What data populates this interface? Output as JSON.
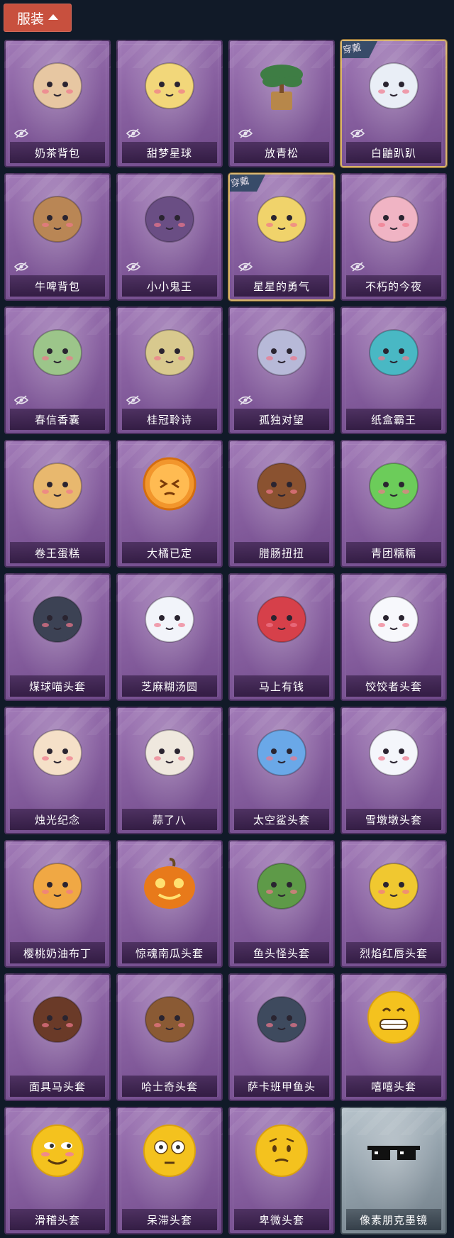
{
  "header": {
    "tab_label": "服装",
    "expanded": true
  },
  "equipped_badge": "穿戴",
  "items": [
    {
      "name": "奶茶背包",
      "hidden": true,
      "equipped": false,
      "icon": "milk-tea-backpack-icon",
      "color": "#e7c7a2"
    },
    {
      "name": "甜梦星球",
      "hidden": true,
      "equipped": false,
      "icon": "sweet-dream-moon-icon",
      "color": "#f2d77a"
    },
    {
      "name": "放青松",
      "hidden": true,
      "equipped": false,
      "icon": "bonsai-pine-icon",
      "color": "#3e7d44"
    },
    {
      "name": "白鼬趴趴",
      "hidden": true,
      "equipped": true,
      "icon": "white-weasel-icon",
      "color": "#e9eef6"
    },
    {
      "name": "牛啤背包",
      "hidden": true,
      "equipped": false,
      "icon": "cow-beer-backpack-icon",
      "color": "#b98655"
    },
    {
      "name": "小小鬼王",
      "hidden": true,
      "equipped": false,
      "icon": "little-ghost-king-icon",
      "color": "#6a4e84"
    },
    {
      "name": "星星的勇气",
      "hidden": true,
      "equipped": true,
      "icon": "star-courage-icon",
      "color": "#f0d36b"
    },
    {
      "name": "不朽的今夜",
      "hidden": true,
      "equipped": false,
      "icon": "immortal-tonight-icon",
      "color": "#f0b4c4"
    },
    {
      "name": "春信香囊",
      "hidden": true,
      "equipped": false,
      "icon": "spring-sachet-icon",
      "color": "#9cc58a"
    },
    {
      "name": "桂冠聆诗",
      "hidden": true,
      "equipped": false,
      "icon": "laurel-poem-icon",
      "color": "#d8c98e"
    },
    {
      "name": "孤独对望",
      "hidden": true,
      "equipped": false,
      "icon": "lonely-gaze-icon",
      "color": "#b7b9d8"
    },
    {
      "name": "纸盒霸王",
      "hidden": false,
      "equipped": false,
      "icon": "cardboard-box-king-icon",
      "color": "#49b8c4"
    },
    {
      "name": "卷王蛋糕",
      "hidden": false,
      "equipped": false,
      "icon": "roll-cake-icon",
      "color": "#e8b86e"
    },
    {
      "name": "大橘已定",
      "hidden": false,
      "equipped": false,
      "icon": "orange-slice-icon",
      "color": "#f2962c"
    },
    {
      "name": "腊肠扭扭",
      "hidden": false,
      "equipped": false,
      "icon": "dachshund-icon",
      "color": "#8a5230"
    },
    {
      "name": "青团糯糯",
      "hidden": false,
      "equipped": false,
      "icon": "green-rice-ball-icon",
      "color": "#6ccc5a"
    },
    {
      "name": "煤球喵头套",
      "hidden": false,
      "equipped": false,
      "icon": "black-cat-head-icon",
      "color": "#3c4254"
    },
    {
      "name": "芝麻糊汤圆",
      "hidden": false,
      "equipped": false,
      "icon": "sesame-dumpling-icon",
      "color": "#f2f4fa"
    },
    {
      "name": "马上有钱",
      "hidden": false,
      "equipped": false,
      "icon": "red-horse-head-icon",
      "color": "#d6404a"
    },
    {
      "name": "饺饺者头套",
      "hidden": false,
      "equipped": false,
      "icon": "dumpling-cloud-head-icon",
      "color": "#f7f8fc"
    },
    {
      "name": "烛光纪念",
      "hidden": false,
      "equipped": false,
      "icon": "candle-head-icon",
      "color": "#f5e0c8"
    },
    {
      "name": "蒜了八",
      "hidden": false,
      "equipped": false,
      "icon": "garlic-head-icon",
      "color": "#efe8de"
    },
    {
      "name": "太空鲨头套",
      "hidden": false,
      "equipped": false,
      "icon": "space-shark-head-icon",
      "color": "#6aa8e8"
    },
    {
      "name": "雪墩墩头套",
      "hidden": false,
      "equipped": false,
      "icon": "snowman-head-icon",
      "color": "#f4f6fb"
    },
    {
      "name": "樱桃奶油布丁",
      "hidden": false,
      "equipped": false,
      "icon": "cherry-pudding-icon",
      "color": "#f0a844"
    },
    {
      "name": "惊魂南瓜头套",
      "hidden": false,
      "equipped": false,
      "icon": "pumpkin-head-icon",
      "color": "#e87a1a"
    },
    {
      "name": "鱼头怪头套",
      "hidden": false,
      "equipped": false,
      "icon": "fish-head-monster-icon",
      "color": "#5e9a48"
    },
    {
      "name": "烈焰红唇头套",
      "hidden": false,
      "equipped": false,
      "icon": "pikachu-lips-head-icon",
      "color": "#f0c830"
    },
    {
      "name": "面具马头套",
      "hidden": false,
      "equipped": false,
      "icon": "horse-mask-icon",
      "color": "#6a3a28"
    },
    {
      "name": "哈士奇头套",
      "hidden": false,
      "equipped": false,
      "icon": "husky-head-icon",
      "color": "#8a5a34"
    },
    {
      "name": "萨卡班甲鱼头",
      "hidden": false,
      "equipped": false,
      "icon": "sacabambaspis-head-icon",
      "color": "#3e4a5e"
    },
    {
      "name": "嘻嘻头套",
      "hidden": false,
      "equipped": false,
      "icon": "grinning-emoji-head-icon",
      "color": "#f4c21e"
    },
    {
      "name": "滑稽头套",
      "hidden": false,
      "equipped": false,
      "icon": "funny-emoji-head-icon",
      "color": "#f4c21e"
    },
    {
      "name": "呆滞头套",
      "hidden": false,
      "equipped": false,
      "icon": "dazed-emoji-head-icon",
      "color": "#f4c21e"
    },
    {
      "name": "卑微头套",
      "hidden": false,
      "equipped": false,
      "icon": "humble-emoji-head-icon",
      "color": "#f4c21e"
    },
    {
      "name": "像素朋克墨镜",
      "hidden": false,
      "equipped": false,
      "icon": "pixel-sunglasses-icon",
      "color": "#111111",
      "rarity": "silver"
    }
  ]
}
